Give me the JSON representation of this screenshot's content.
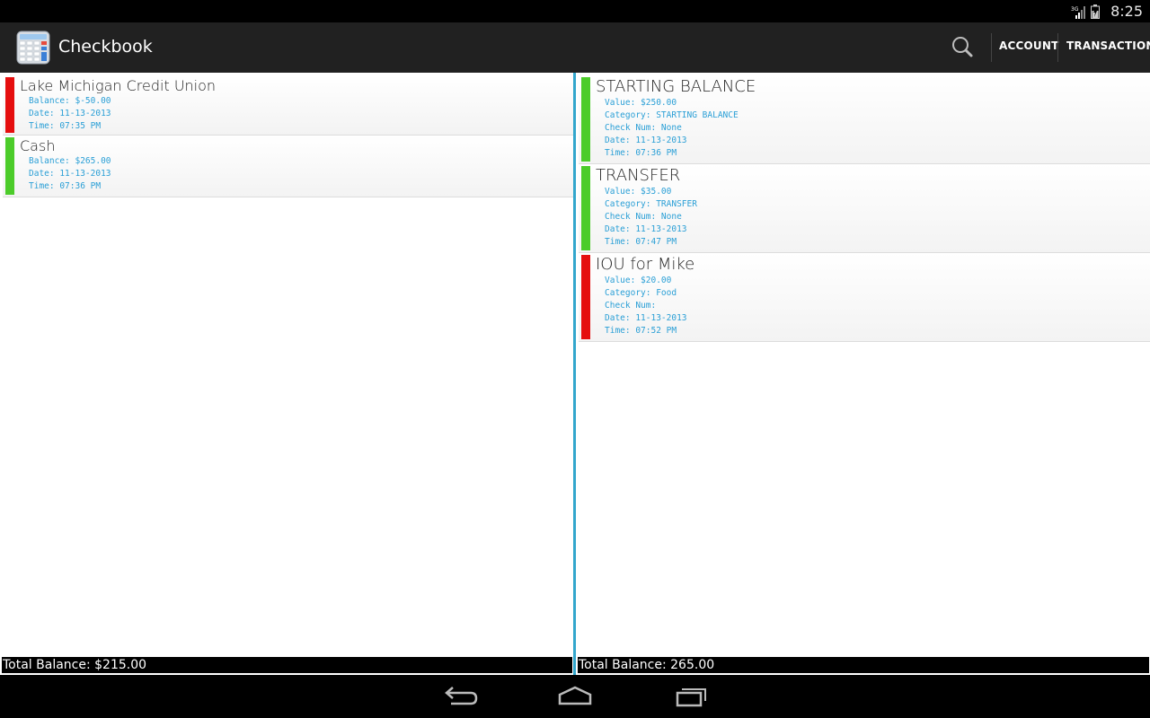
{
  "status": {
    "time": "8:25",
    "network": "3G"
  },
  "app": {
    "title": "Checkbook"
  },
  "actions": {
    "account": "ACCOUNT",
    "transaction": "TRANSACTION"
  },
  "colors": {
    "positive": "#4ccc2a",
    "negative": "#e50e0e",
    "accent": "#33a6cc"
  },
  "accounts": [
    {
      "name": "Lake Michigan Credit Union",
      "balance": "Balance: $-50.00",
      "date": "Date: 11-13-2013",
      "time": "Time: 07:35 PM",
      "status": "negative"
    },
    {
      "name": "Cash",
      "balance": "Balance: $265.00",
      "date": "Date: 11-13-2013",
      "time": "Time: 07:36 PM",
      "status": "positive"
    }
  ],
  "accounts_total": "Total Balance: $215.00",
  "transactions": [
    {
      "name": "STARTING BALANCE",
      "value": "Value: $250.00",
      "category": "Category: STARTING BALANCE",
      "check": "Check Num: None",
      "date": "Date: 11-13-2013",
      "time": "Time: 07:36 PM",
      "status": "positive"
    },
    {
      "name": "TRANSFER",
      "value": "Value: $35.00",
      "category": "Category: TRANSFER",
      "check": "Check Num: None",
      "date": "Date: 11-13-2013",
      "time": "Time: 07:47 PM",
      "status": "positive"
    },
    {
      "name": "IOU for Mike",
      "value": "Value: $20.00",
      "category": "Category: Food",
      "check": "Check Num:",
      "date": "Date: 11-13-2013",
      "time": "Time: 07:52 PM",
      "status": "negative"
    }
  ],
  "transactions_total": "Total Balance: 265.00",
  "nav": {
    "back": "back-icon",
    "home": "home-icon",
    "recents": "recents-icon"
  }
}
